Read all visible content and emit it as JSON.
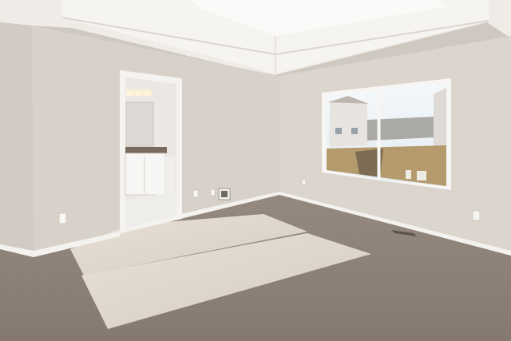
{
  "scene": {
    "kind": "photo",
    "subject": "empty-bedroom-interior",
    "colors": {
      "ceiling": "#f3f1ee",
      "wall_left": "#d6cfc8",
      "wall_back": "#d9d2ca",
      "wall_right": "#ddd6ce",
      "carpet": "#8d8077",
      "sunlight": "#e6ded4",
      "trim": "#f4f2ef",
      "sky": "#eef3f7",
      "lawn": "#b9a072"
    }
  }
}
